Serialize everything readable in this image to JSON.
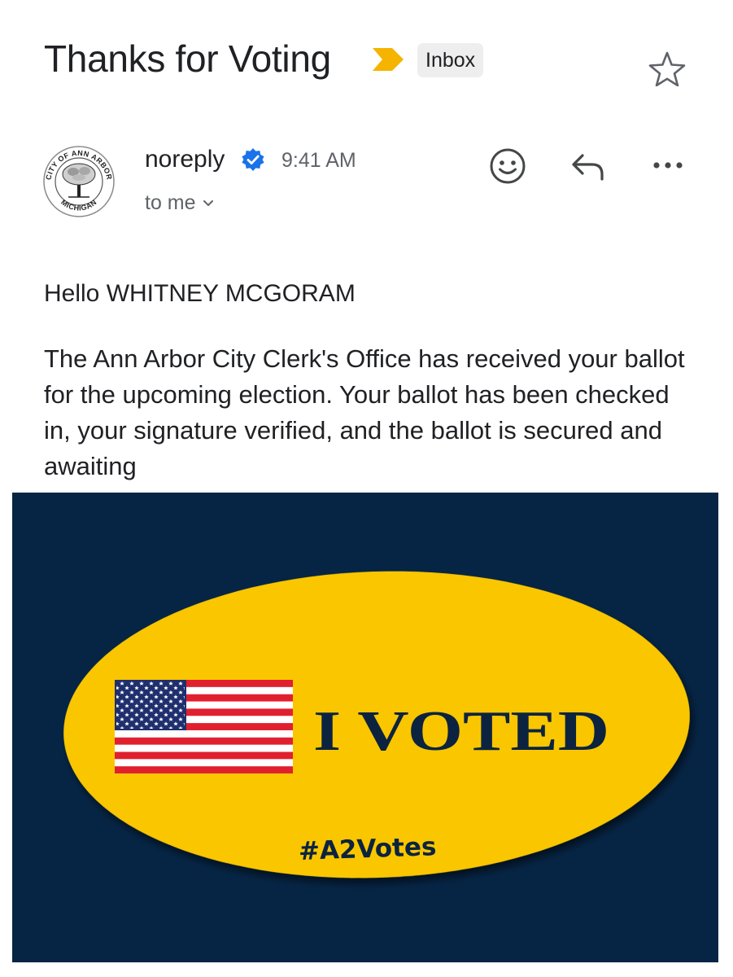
{
  "email": {
    "subject": "Thanks for Voting",
    "label": "Inbox",
    "sender": "noreply",
    "time": "9:41 AM",
    "recipient": "to me",
    "greeting": "Hello WHITNEY MCGORAM",
    "body": "The Ann Arbor City Clerk's Office has received your ballot for the upcoming election. Your ballot has been checked in, your signature verified, and the ballot is secured and awaiting"
  },
  "avatar": {
    "seal_top": "CITY OF ANN ARBOR",
    "seal_bottom": "MICHIGAN"
  },
  "banner": {
    "headline": "I VOTED",
    "hashtag": "#A2Votes"
  },
  "icons": {
    "importance": "importance-marker-icon",
    "star": "star-icon",
    "verified": "verified-badge-icon",
    "chevron": "chevron-down-icon",
    "emoji": "add-reaction-icon",
    "reply": "reply-icon",
    "more": "more-options-icon"
  },
  "colors": {
    "importance": "#f4b400",
    "verified": "#1a73e8",
    "banner_bg": "#062545",
    "sticker_fill": "#f9c600",
    "sticker_text": "#0c2340",
    "flag_red": "#e0202e",
    "flag_blue": "#1f2f6e"
  }
}
